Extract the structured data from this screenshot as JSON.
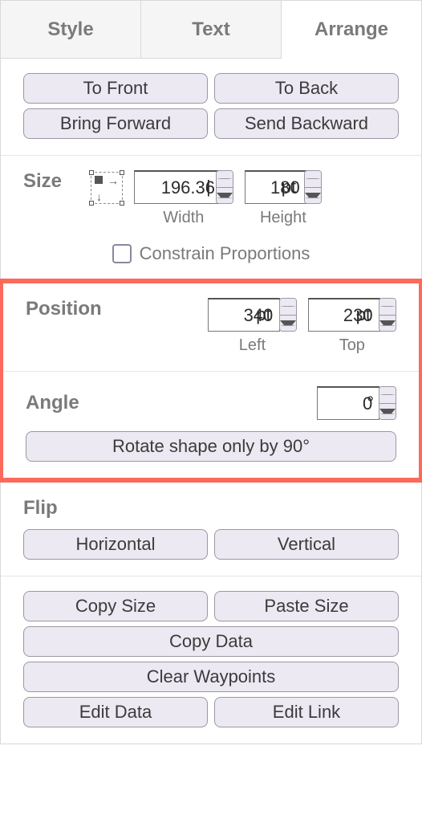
{
  "tabs": {
    "style": "Style",
    "text": "Text",
    "arrange": "Arrange"
  },
  "order": {
    "to_front": "To Front",
    "to_back": "To Back",
    "bring_forward": "Bring Forward",
    "send_backward": "Send Backward"
  },
  "size": {
    "label": "Size",
    "width_value": "196.36",
    "width_unit": "|",
    "width_label": "Width",
    "height_value": "180",
    "height_unit": "pt",
    "height_label": "Height",
    "constrain": "Constrain Proportions"
  },
  "position": {
    "label": "Position",
    "left_value": "340",
    "left_unit": "pt",
    "left_label": "Left",
    "top_value": "230",
    "top_unit": "pt",
    "top_label": "Top"
  },
  "angle": {
    "label": "Angle",
    "value": "0",
    "unit": "°",
    "rotate_btn": "Rotate shape only by 90°"
  },
  "flip": {
    "label": "Flip",
    "horizontal": "Horizontal",
    "vertical": "Vertical"
  },
  "actions": {
    "copy_size": "Copy Size",
    "paste_size": "Paste Size",
    "copy_data": "Copy Data",
    "clear_waypoints": "Clear Waypoints",
    "edit_data": "Edit Data",
    "edit_link": "Edit Link"
  }
}
